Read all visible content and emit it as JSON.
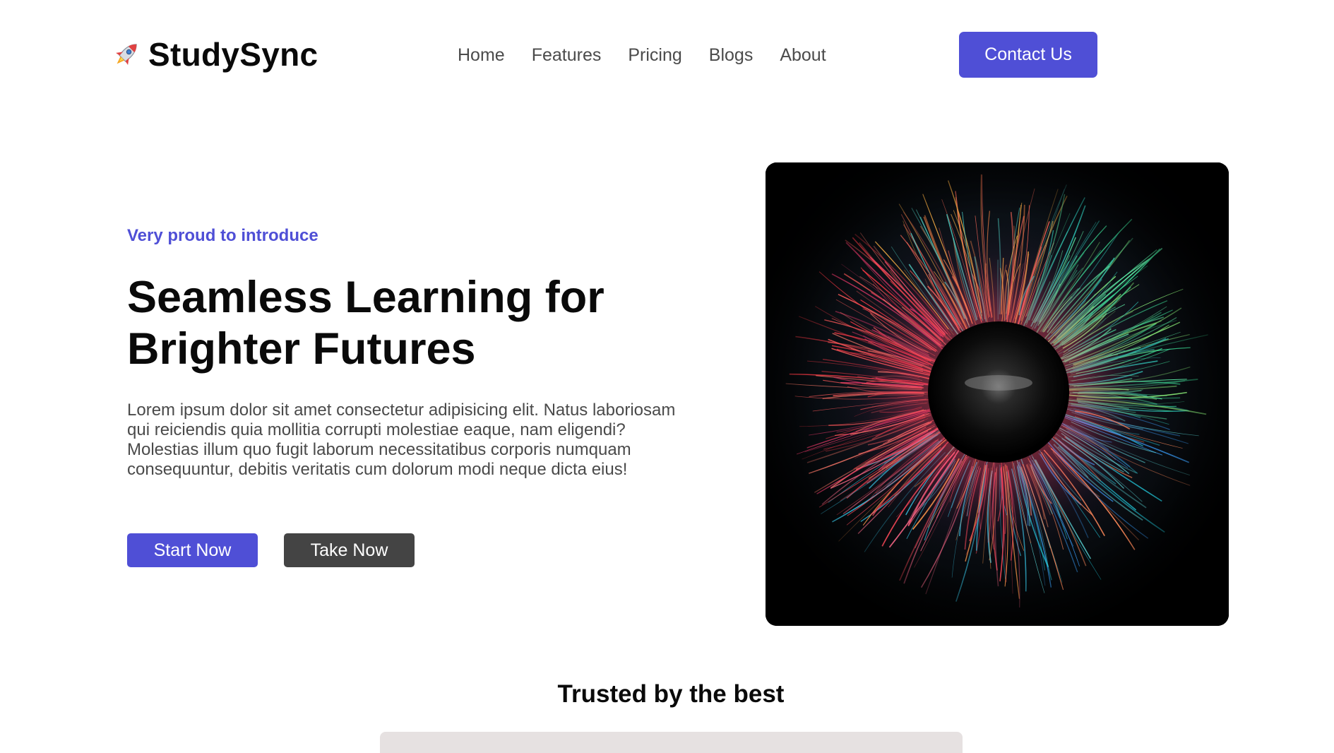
{
  "brand": {
    "name": "StudySync",
    "logo_icon": "rocket-icon"
  },
  "nav": {
    "items": [
      {
        "label": "Home"
      },
      {
        "label": "Features"
      },
      {
        "label": "Pricing"
      },
      {
        "label": "Blogs"
      },
      {
        "label": "About"
      }
    ],
    "contact_label": "Contact Us"
  },
  "hero": {
    "eyebrow": "Very proud to introduce",
    "title_line1": "Seamless Learning for",
    "title_line2": "Brighter Futures",
    "description": "Lorem ipsum dolor sit amet consectetur adipisicing elit. Natus laboriosam qui reiciendis quia mollitia corrupti molestiae eaque, nam eligendi? Molestias illum quo fugit laborum necessitatibus corporis numquam consequuntur, debitis veritatis cum dolorum modi neque dicta eius!",
    "primary_button": "Start Now",
    "secondary_button": "Take Now",
    "image_alt": "colorful iris"
  },
  "trusted": {
    "title": "Trusted by the best"
  },
  "colors": {
    "accent": "#4f4fd6",
    "dark_button": "#444444",
    "text_dark": "#0a0a0a",
    "text_muted": "#4a4a4a",
    "strip": "#e6e1e1"
  }
}
